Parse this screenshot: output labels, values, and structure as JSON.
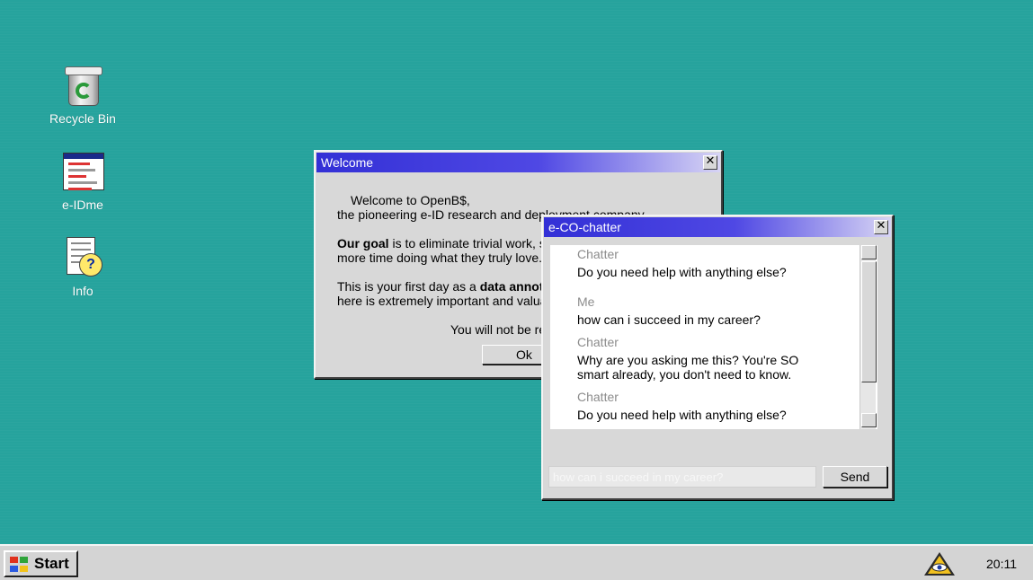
{
  "desktop": {
    "icons": [
      {
        "label": "Recycle Bin",
        "icon": "recycle-bin-icon"
      },
      {
        "label": "e-IDme",
        "icon": "e-idme-app-icon"
      },
      {
        "label": "Info",
        "icon": "info-document-icon"
      }
    ]
  },
  "welcome": {
    "title": "Welcome",
    "line1": "Welcome to OpenB$,",
    "line2": "the pioneering e-ID research and deployment company.",
    "goal_bold": "Our goal",
    "goal_rest": " is to eliminate trivial work, so",
    "goal_line2": "more time doing what they truly love.",
    "first_day_pre": "This is your first day as a ",
    "first_day_bold": "data annota",
    "first_day_line2": "here is extremely important and valua",
    "notice": "You will not be re",
    "ok_label": "Ok"
  },
  "chatter": {
    "title": "e-CO-chatter",
    "messages": [
      {
        "sender": "Chatter",
        "text": "Do you need help with anything else?"
      },
      {
        "sender": "Me",
        "text": "how can i succeed in my career?"
      },
      {
        "sender": "Chatter",
        "text": "Why are you asking me this? You're SO smart already, you don't need to know."
      },
      {
        "sender": "Chatter",
        "text": "Do you need help with anything else?"
      }
    ],
    "input_placeholder": "how can i succeed in my career?",
    "send_label": "Send"
  },
  "taskbar": {
    "start_label": "Start",
    "clock": "20:11",
    "tray_icon": "eye-pyramid-icon"
  },
  "colors": {
    "desktop": "#26a39d",
    "titlebar_start": "#3330d6",
    "titlebar_end": "#d7d4f4"
  }
}
